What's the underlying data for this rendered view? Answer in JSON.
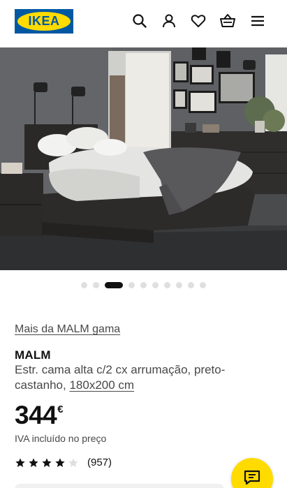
{
  "header": {
    "logo_text": "IKEA",
    "icons": [
      "search-icon",
      "account-icon",
      "heart-icon",
      "basket-icon",
      "menu-icon"
    ]
  },
  "hero": {
    "image": "bedroom-photo"
  },
  "carousel": {
    "total": 10,
    "active_index": 2
  },
  "product": {
    "range_link": "Mais da MALM gama",
    "name": "MALM",
    "description": "Estr. cama alta c/2 cx arrumação, preto-castanho,",
    "size": "180x200 cm",
    "price_integer": "344",
    "price_currency": "€",
    "vat_note": "IVA incluído no preço",
    "rating_value": 4,
    "rating_max": 5,
    "review_count": "(957)"
  },
  "colors": {
    "brand_blue": "#0058a3",
    "brand_yellow": "#ffdb00",
    "text": "#111111",
    "muted_text": "#484848"
  }
}
